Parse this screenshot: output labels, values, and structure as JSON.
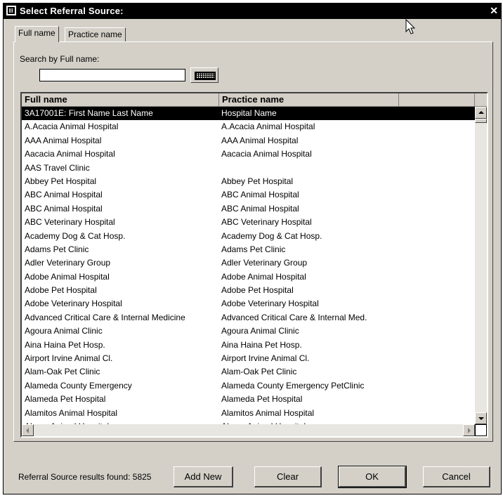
{
  "window": {
    "title": "Select Referral Source:",
    "close_glyph": "✕"
  },
  "tabs": [
    {
      "label": "Full name",
      "active": true
    },
    {
      "label": "Practice name",
      "active": false
    }
  ],
  "search": {
    "label": "Search by Full name:",
    "value": "",
    "placeholder": ""
  },
  "grid": {
    "columns": [
      "Full name",
      "Practice name"
    ],
    "rows": [
      {
        "full_name": "3A17001E: First Name Last Name",
        "practice_name": "Hospital Name",
        "selected": true
      },
      {
        "full_name": "A.Acacia Animal Hospital",
        "practice_name": "A.Acacia Animal Hospital"
      },
      {
        "full_name": "AAA Animal Hospital",
        "practice_name": "AAA Animal Hospital"
      },
      {
        "full_name": "Aacacia Animal Hospital",
        "practice_name": "Aacacia Animal Hospital"
      },
      {
        "full_name": "AAS Travel Clinic",
        "practice_name": ""
      },
      {
        "full_name": "Abbey Pet Hospital",
        "practice_name": "Abbey Pet Hospital"
      },
      {
        "full_name": "ABC Animal Hospital",
        "practice_name": "ABC Animal Hospital"
      },
      {
        "full_name": "ABC Animal Hospital",
        "practice_name": "ABC Animal Hospital"
      },
      {
        "full_name": "ABC Veterinary Hospital",
        "practice_name": "ABC Veterinary Hospital"
      },
      {
        "full_name": "Academy Dog & Cat Hosp.",
        "practice_name": "Academy Dog & Cat Hosp."
      },
      {
        "full_name": "Adams Pet Clinic",
        "practice_name": "Adams Pet Clinic"
      },
      {
        "full_name": "Adler Veterinary Group",
        "practice_name": "Adler Veterinary Group"
      },
      {
        "full_name": "Adobe Animal Hospital",
        "practice_name": "Adobe Animal Hospital"
      },
      {
        "full_name": "Adobe Pet Hospital",
        "practice_name": "Adobe Pet Hospital"
      },
      {
        "full_name": "Adobe Veterinary Hospital",
        "practice_name": "Adobe Veterinary Hospital"
      },
      {
        "full_name": "Advanced  Critical Care & Internal Medicine",
        "practice_name": "Advanced Critical Care & Internal Med."
      },
      {
        "full_name": "Agoura Animal Clinic",
        "practice_name": "Agoura Animal Clinic"
      },
      {
        "full_name": "Aina Haina Pet Hosp.",
        "practice_name": "Aina Haina Pet Hosp."
      },
      {
        "full_name": "Airport Irvine Animal Cl.",
        "practice_name": "Airport Irvine Animal Cl."
      },
      {
        "full_name": "Alam-Oak Pet Clinic",
        "practice_name": "Alam-Oak Pet Clinic"
      },
      {
        "full_name": "Alameda County Emergency",
        "practice_name": "Alameda County Emergency PetClinic"
      },
      {
        "full_name": "Alameda Pet Hospital",
        "practice_name": "Alameda Pet Hospital"
      },
      {
        "full_name": "Alamitos Animal Hospital",
        "practice_name": "Alamitos Animal Hospital"
      },
      {
        "full_name": "Alamo Animal Hospital",
        "practice_name": "Alamo Animal Hospital"
      }
    ]
  },
  "footer": {
    "results_label": "Referral Source results found:",
    "results_count": "5825",
    "buttons": {
      "add_new": "Add New",
      "clear": "Clear",
      "ok": "OK",
      "cancel": "Cancel"
    }
  }
}
